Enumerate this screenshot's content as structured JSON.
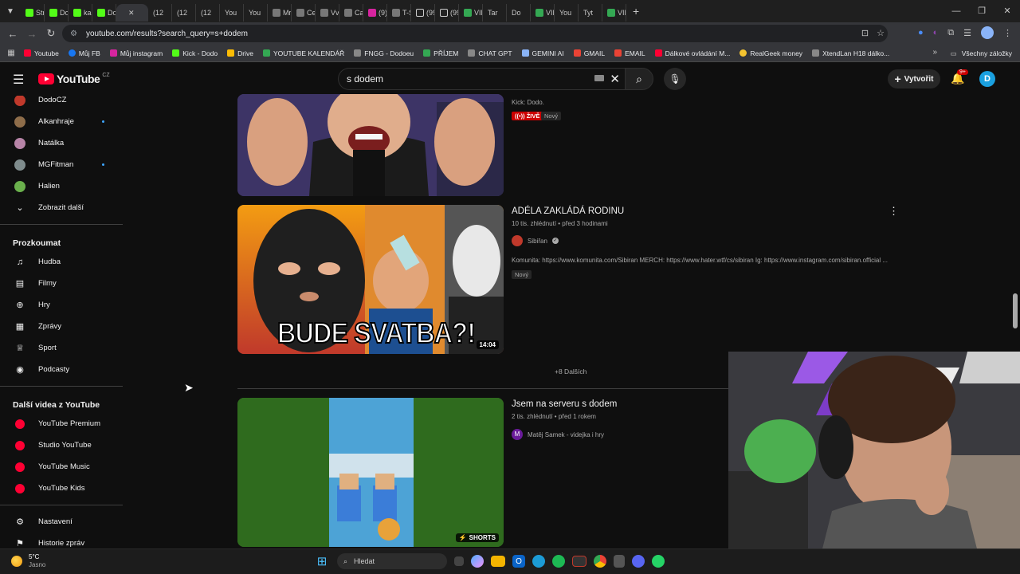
{
  "browser": {
    "tabs": [
      {
        "label": "Stre",
        "icon": "kick"
      },
      {
        "label": "Do",
        "icon": "kick"
      },
      {
        "label": "kas",
        "icon": "kick"
      },
      {
        "label": "Do",
        "icon": "kick"
      },
      {
        "label": "",
        "icon": "yt",
        "active": true
      },
      {
        "label": "(12",
        "icon": "yt"
      },
      {
        "label": "(12",
        "icon": "yt"
      },
      {
        "label": "(12",
        "icon": "yt"
      },
      {
        "label": "You",
        "icon": "yt"
      },
      {
        "label": "You",
        "icon": "yt"
      },
      {
        "label": "Mrl",
        "icon": "grey"
      },
      {
        "label": "Cel",
        "icon": "grey"
      },
      {
        "label": "Vve",
        "icon": "grey"
      },
      {
        "label": "Car",
        "icon": "grey"
      },
      {
        "label": "(9)",
        "icon": "ig"
      },
      {
        "label": "T-S",
        "icon": "grey"
      },
      {
        "label": "(99",
        "icon": "tt"
      },
      {
        "label": "(99",
        "icon": "tt"
      },
      {
        "label": "VID",
        "icon": "grid"
      },
      {
        "label": "Tar",
        "icon": "yt"
      },
      {
        "label": "Do",
        "icon": "yt"
      },
      {
        "label": "VID",
        "icon": "grid"
      },
      {
        "label": "You",
        "icon": "yt"
      },
      {
        "label": "Tyt",
        "icon": "yt"
      },
      {
        "label": "VID",
        "icon": "grid"
      }
    ],
    "url": "youtube.com/results?search_query=s+dodem",
    "bookmarks": [
      {
        "label": "Youtube",
        "icon": "yt"
      },
      {
        "label": "Můj FB",
        "icon": "fb"
      },
      {
        "label": "Můj instagram",
        "icon": "ig"
      },
      {
        "label": "Kick - Dodo",
        "icon": "kick"
      },
      {
        "label": "Drive",
        "icon": "drive"
      },
      {
        "label": "YOUTUBE KALENDÁŘ",
        "icon": "grid"
      },
      {
        "label": "FNGG - Dodoeu",
        "icon": "grey"
      },
      {
        "label": "PŘÍJEM",
        "icon": "grid"
      },
      {
        "label": "CHAT GPT",
        "icon": "grey"
      },
      {
        "label": "GEMINI AI",
        "icon": "gemini"
      },
      {
        "label": "GMAIL",
        "icon": "gmail"
      },
      {
        "label": "EMAIL",
        "icon": "gmail"
      },
      {
        "label": "Dálkové ovládání M...",
        "icon": "yt"
      },
      {
        "label": "RealGeek money",
        "icon": "coin"
      },
      {
        "label": "XtendLan H18 dálko...",
        "icon": "grey"
      }
    ],
    "all_bookmarks": "Všechny záložky"
  },
  "youtube": {
    "logo_text": "YouTube",
    "region": "CZ",
    "search_value": "s dodem",
    "create_label": "Vytvořit",
    "notif_badge": "9+",
    "avatar_letter": "D"
  },
  "sidebar": {
    "subscriptions": [
      {
        "label": "DodoCZ",
        "color": "#c0392b",
        "dot": false
      },
      {
        "label": "Alkanhraje",
        "color": "#8e6d4a",
        "dot": true
      },
      {
        "label": "Natálka",
        "color": "#b784a7",
        "dot": false
      },
      {
        "label": "MGFitman",
        "color": "#7f8c8d",
        "dot": true
      },
      {
        "label": "Halien",
        "color": "#6ab04c",
        "dot": false
      }
    ],
    "show_more": "Zobrazit další",
    "explore_title": "Prozkoumat",
    "explore": [
      {
        "label": "Hudba",
        "icon": "music-note-icon",
        "glyph": "♫"
      },
      {
        "label": "Filmy",
        "icon": "film-icon",
        "glyph": "▤"
      },
      {
        "label": "Hry",
        "icon": "gamepad-icon",
        "glyph": "⊕"
      },
      {
        "label": "Zprávy",
        "icon": "news-icon",
        "glyph": "▦"
      },
      {
        "label": "Sport",
        "icon": "trophy-icon",
        "glyph": "♕"
      },
      {
        "label": "Podcasty",
        "icon": "podcast-icon",
        "glyph": "◉"
      }
    ],
    "more_title": "Další videa z YouTube",
    "more": [
      {
        "label": "YouTube Premium"
      },
      {
        "label": "Studio YouTube"
      },
      {
        "label": "YouTube Music"
      },
      {
        "label": "YouTube Kids"
      }
    ],
    "settings": [
      {
        "label": "Nastavení",
        "icon": "gear-icon",
        "glyph": "⚙"
      },
      {
        "label": "Historie zpráv",
        "icon": "flag-icon",
        "glyph": "⚑"
      }
    ]
  },
  "results": {
    "first": {
      "desc": "Kick: Dodo.",
      "live": "((•)) ŽIVĚ",
      "new": "Nový"
    },
    "second": {
      "title": "ADÉLA ZAKLÁDÁ RODINU",
      "meta": "10 tis. zhlédnutí • před 3 hodinami",
      "channel": "Sibiřan",
      "desc": "Komunita: https://www.komunita.com/Sibiran MERCH: https://www.hater.wtf/cs/sibiran Ig: https://www.instagram.com/sibiran.official ...",
      "new": "Nový",
      "duration": "14:04",
      "thumb_text": "BUDE SVATBA?!"
    },
    "more_results": "+8 Dalších",
    "third": {
      "title": "Jsem na serveru s dodem",
      "meta": "2 tis. zhlédnutí • před 1 rokem",
      "channel": "Matěj Samek - videjka i hry",
      "channel_initial": "M",
      "shorts": "SHORTS"
    }
  },
  "taskbar": {
    "temp": "5°C",
    "weather": "Jasno",
    "search": "Hledat"
  }
}
